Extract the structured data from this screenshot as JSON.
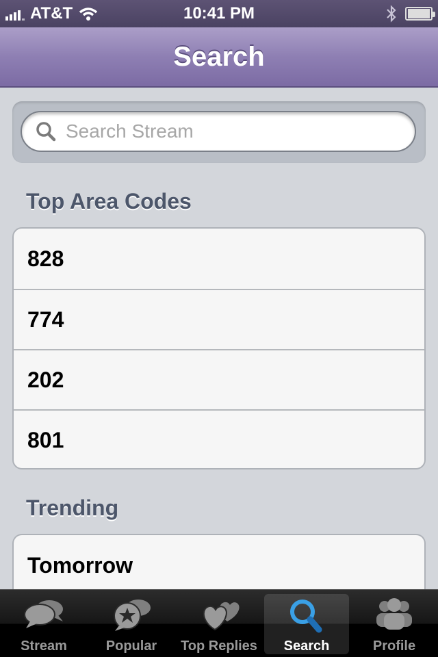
{
  "status_bar": {
    "carrier": "AT&T",
    "time": "10:41 PM"
  },
  "nav": {
    "title": "Search"
  },
  "search": {
    "placeholder": "Search Stream",
    "value": ""
  },
  "sections": {
    "area_codes": {
      "title": "Top Area Codes",
      "items": [
        "828",
        "774",
        "202",
        "801"
      ]
    },
    "trending": {
      "title": "Trending",
      "items": [
        "Tomorrow"
      ]
    }
  },
  "tabs": [
    {
      "label": "Stream",
      "icon": "chat-bubbles-icon",
      "selected": false
    },
    {
      "label": "Popular",
      "icon": "star-bubble-icon",
      "selected": false
    },
    {
      "label": "Top Replies",
      "icon": "hearts-icon",
      "selected": false
    },
    {
      "label": "Search",
      "icon": "magnifier-icon",
      "selected": true
    },
    {
      "label": "Profile",
      "icon": "people-icon",
      "selected": false
    }
  ],
  "colors": {
    "nav_purple": "#8e7fb3",
    "selected_tab_icon": "#3aa0e6"
  }
}
